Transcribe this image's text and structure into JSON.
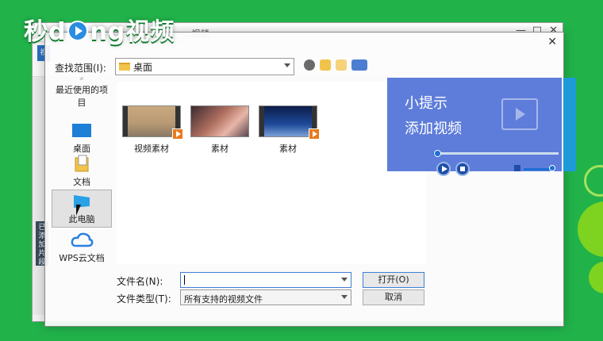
{
  "logo": {
    "text_pre": "秒d",
    "text_post": "ng视频"
  },
  "background_app": {
    "title": "...视频",
    "min": "—",
    "max": "□",
    "close": "✕",
    "tab": "视",
    "side_btn": "已添加片段"
  },
  "tip": {
    "title": "小提示",
    "text": "添加视频",
    "progress": 0.02,
    "volume": 0.9
  },
  "dialog": {
    "close": "✕",
    "look_in_label": "查找范围(I):",
    "look_in_value": "桌面",
    "places": [
      {
        "label": "最近使用的项目",
        "icon": "recent-items-icon"
      },
      {
        "label": "桌面",
        "icon": "desktop-icon"
      },
      {
        "label": "文档",
        "icon": "documents-icon"
      },
      {
        "label": "此电脑",
        "icon": "this-pc-icon"
      },
      {
        "label": "WPS云文档",
        "icon": "wps-cloud-icon"
      }
    ],
    "files": [
      {
        "name": "视频素材"
      },
      {
        "name": "素材"
      },
      {
        "name": "素材"
      }
    ],
    "filename_label": "文件名(N):",
    "filename_value": "",
    "filetype_label": "文件类型(T):",
    "filetype_value": "所有支持的视频文件",
    "open_button": "打开(O)",
    "cancel_button": "取消"
  },
  "colors": {
    "frame_green": "#21b24a",
    "tip_blue": "#3a60d2",
    "accent_blue": "#1e9ad9"
  }
}
